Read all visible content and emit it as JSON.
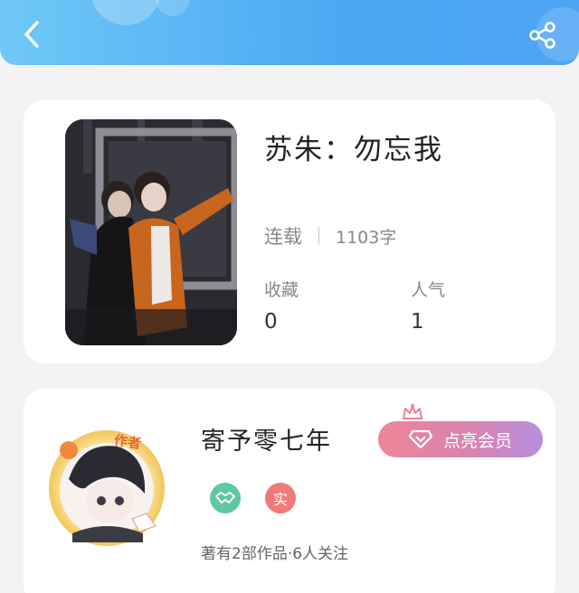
{
  "header": {
    "back_icon": "chevron-left-icon",
    "share_icon": "share-icon"
  },
  "book": {
    "title": "苏朱：勿忘我",
    "status": "连载",
    "word_count": "1103字",
    "favorites_label": "收藏",
    "favorites_value": "0",
    "popularity_label": "人气",
    "popularity_value": "1"
  },
  "author": {
    "name": "寄予零七年",
    "avatar_tag": "作者",
    "vip_button_label": "点亮会员",
    "badge_real": "实",
    "stats": "著有2部作品·6人关注"
  },
  "colors": {
    "header_start": "#6fc8f6",
    "header_end": "#4da5f4",
    "vip_gradient_start": "#ee8595",
    "vip_gradient_end": "#b68fdf",
    "badge_green": "#5fc7a4",
    "badge_red": "#f07a78"
  }
}
